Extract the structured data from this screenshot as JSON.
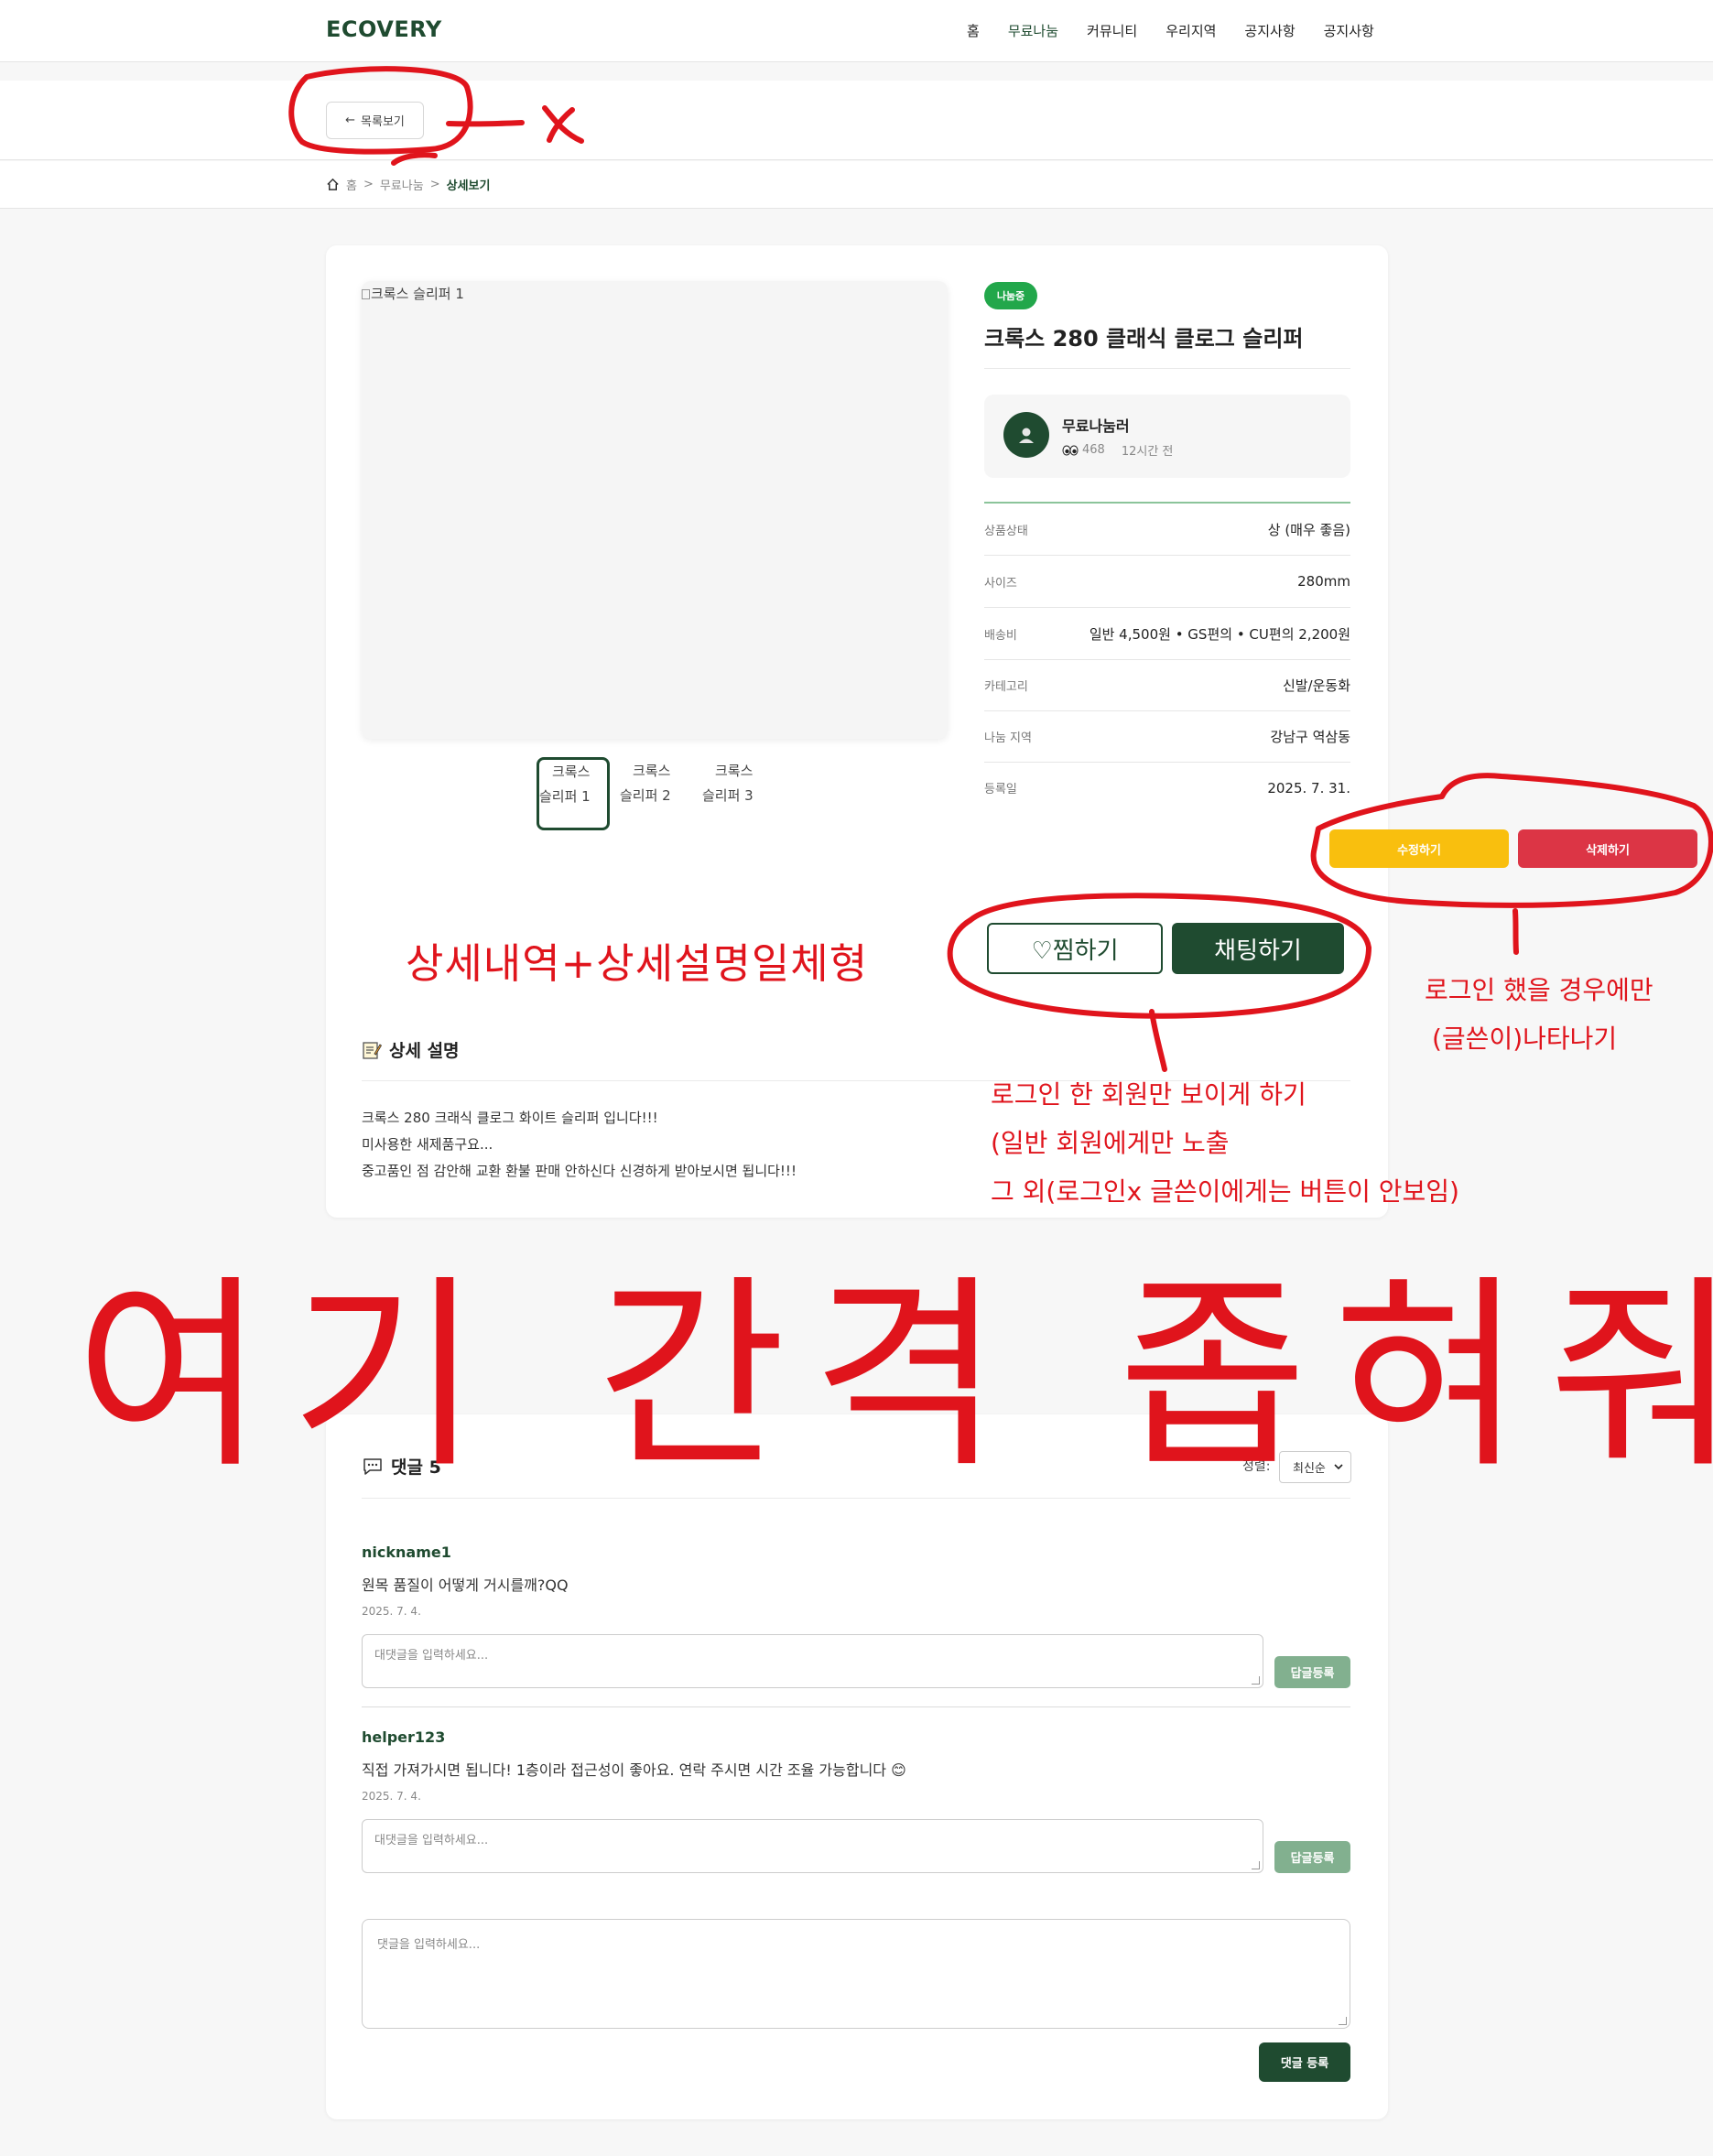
{
  "header": {
    "logo": "ECOVERY",
    "nav": [
      "홈",
      "무료나눔",
      "커뮤니티",
      "우리지역",
      "공지사항",
      "공지사항"
    ]
  },
  "back_button": {
    "arrow": "←",
    "label": "목록보기"
  },
  "breadcrumb": {
    "home": "홈",
    "sep": ">",
    "category": "무료나눔",
    "current": "상세보기"
  },
  "gallery": {
    "main_alt": "크록스 슬리퍼 1",
    "thumbs": [
      {
        "line1": "크록스",
        "line2": "슬리퍼 1"
      },
      {
        "line1": "크록스",
        "line2": "슬리퍼 2"
      },
      {
        "line1": "크록스",
        "line2": "슬리퍼 3"
      }
    ]
  },
  "product": {
    "badge": "나눔중",
    "title": "크록스 280 클래식 클로그 슬리퍼",
    "seller_name": "무료나눔러",
    "views": "468",
    "posted": "12시간 전",
    "info": [
      {
        "key": "상품상태",
        "value": "상 (매우 좋음)"
      },
      {
        "key": "사이즈",
        "value": "280mm"
      },
      {
        "key": "배송비",
        "value": "일반 4,500원 • GS편의 • CU편의 2,200원"
      },
      {
        "key": "카테고리",
        "value": "신발/운동화"
      },
      {
        "key": "나눔 지역",
        "value": "강남구 역삼동"
      },
      {
        "key": "등록일",
        "value": "2025. 7. 31."
      }
    ],
    "edit_label": "수정하기",
    "delete_label": "삭제하기",
    "like_label": "♡찜하기",
    "chat_label": "채팅하기"
  },
  "description": {
    "title": "상세 설명",
    "lines": [
      "크록스 280 크래식 클로그 화이트 슬리퍼 입니다!!!",
      "미사용한 새제품구요...",
      "중고품인 점 감안해 교환 환불 판매 안하신다 신경하게 받아보시면 됩니다!!!"
    ]
  },
  "comments": {
    "title": "댓글 5",
    "sort_label": "정렬:",
    "sort_value": "최신순",
    "items": [
      {
        "nick": "nickname1",
        "text": "원목 품질이 어떻게 거시를깨?QQ",
        "date": "2025. 7. 4."
      },
      {
        "nick": "helper123",
        "text": "직접 가져가시면 됩니다! 1층이라 접근성이 좋아요. 연락 주시면 시간 조율 가능합니다 😊",
        "date": "2025. 7. 4."
      }
    ],
    "reply_placeholder": "대댓글을 입력하세요...",
    "reply_button": "답글등록",
    "main_placeholder": "댓글을 입력하세요...",
    "submit_button": "댓글 등록"
  },
  "annotations": {
    "arrow_x": "x",
    "integrated": "상세내역+상세설명일체형",
    "login_only": [
      "로그인 한 회원만 보이게 하기",
      "(일반 회원에게만 노출",
      "그 외(로그인x 글쓴이에게는 버튼이 안보임)"
    ],
    "author_only": [
      "로그인 했을 경우에만",
      "(글쓴이)나타나기"
    ],
    "narrow_gap": "여기 간격 좁혀줘",
    "ink_color": "#e0141c"
  }
}
